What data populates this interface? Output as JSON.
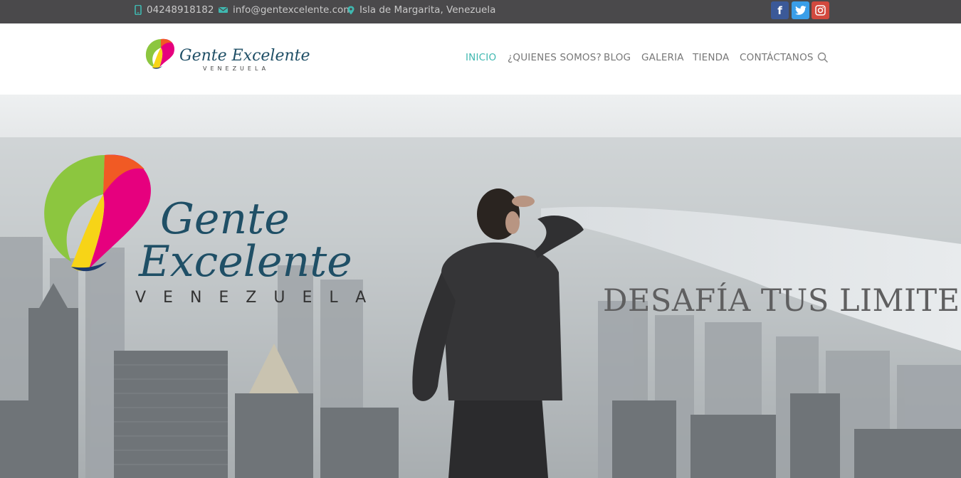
{
  "topbar": {
    "phone": "04248918182",
    "email": "info@gentexcelente.com",
    "location": "Isla de Margarita, Venezuela",
    "icons": {
      "phone": "phone-icon",
      "email": "envelope-icon",
      "location": "map-pin-icon"
    },
    "social": [
      {
        "name": "facebook-icon",
        "glyph": "f",
        "color": "#3b5998"
      },
      {
        "name": "twitter-icon",
        "glyph": "t",
        "color": "#3a9ee8"
      },
      {
        "name": "instagram-icon",
        "glyph": "ig",
        "color": "#d2493e"
      }
    ]
  },
  "brand": {
    "name_line1": "Gente Excelente",
    "hero_line1": "Gente",
    "hero_line2": "Excelente",
    "country": "VENEZUELA",
    "accent_color": "#3fb8b0",
    "logo_colors": [
      "#8cc63f",
      "#e6007e",
      "#f7d417",
      "#f15a24",
      "#1b3a6b"
    ]
  },
  "nav": {
    "items": [
      {
        "label": "INICIO",
        "active": true
      },
      {
        "label": "¿QUIENES SOMOS?",
        "active": false
      },
      {
        "label": "BLOG",
        "active": false
      },
      {
        "label": "GALERIA",
        "active": false
      },
      {
        "label": "TIENDA",
        "active": false
      },
      {
        "label": "CONTÁCTANOS",
        "active": false
      }
    ],
    "search_icon": "search-icon"
  },
  "hero": {
    "headline": "DESAFÍA TUS LIMITES"
  }
}
